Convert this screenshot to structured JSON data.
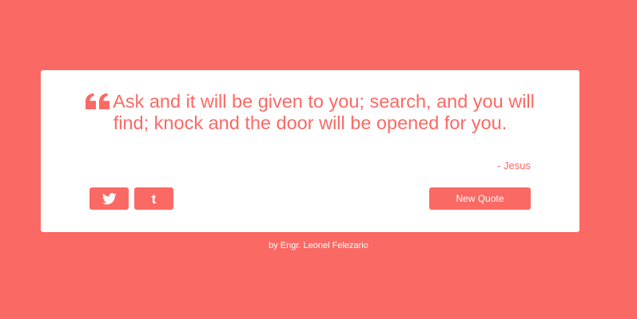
{
  "quote": {
    "text": "Ask and it will be given to you; search, and you will find; knock and the door will be opened for you.",
    "author": "- Jesus",
    "quote_icon": "quote-left-icon"
  },
  "share": {
    "twitter_icon": "twitter-icon",
    "tumblr_icon": "tumblr-icon",
    "tumblr_glyph": "t"
  },
  "actions": {
    "new_quote_label": "New Quote"
  },
  "footer": {
    "credit": "by Engr. Leonel Felezario"
  },
  "colors": {
    "background": "#fb6964",
    "card": "#ffffff",
    "accent": "#fb6964"
  }
}
